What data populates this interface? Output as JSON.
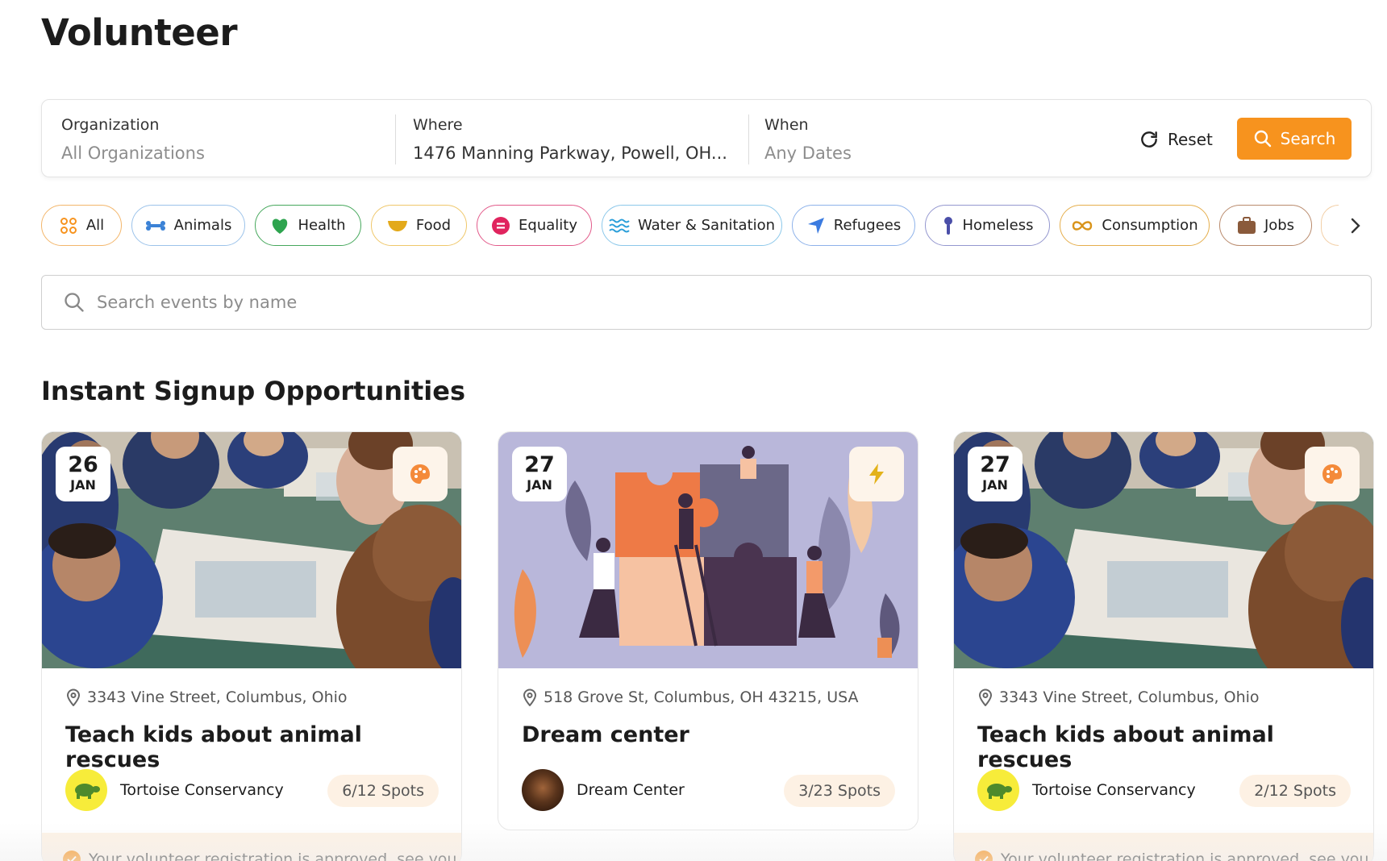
{
  "page": {
    "title": "Volunteer"
  },
  "filters": {
    "organization": {
      "label": "Organization",
      "value": "All Organizations"
    },
    "where": {
      "label": "Where",
      "value": "1476 Manning Parkway, Powell, OH..."
    },
    "when": {
      "label": "When",
      "value": "Any Dates"
    },
    "reset_label": "Reset",
    "search_label": "Search",
    "accent": "#f7931e"
  },
  "categories": [
    {
      "label": "All",
      "icon": "grid-circles-icon",
      "color": "#f7931e"
    },
    {
      "label": "Animals",
      "icon": "bone-icon",
      "color": "#3b82d6"
    },
    {
      "label": "Health",
      "icon": "heart-icon",
      "color": "#2ea44f"
    },
    {
      "label": "Food",
      "icon": "bowl-icon",
      "color": "#e3a91a"
    },
    {
      "label": "Equality",
      "icon": "equality-icon",
      "color": "#e0245e"
    },
    {
      "label": "Water & Sanitation",
      "icon": "waves-icon",
      "color": "#2c9fd9"
    },
    {
      "label": "Refugees",
      "icon": "paper-plane-icon",
      "color": "#3b7be0"
    },
    {
      "label": "Homeless",
      "icon": "pin-person-icon",
      "color": "#4a4ea8"
    },
    {
      "label": "Consumption",
      "icon": "infinity-icon",
      "color": "#d9941a"
    },
    {
      "label": "Jobs",
      "icon": "briefcase-icon",
      "color": "#8a5a3b"
    }
  ],
  "event_search": {
    "placeholder": "Search events by name"
  },
  "section": {
    "title": "Instant Signup Opportunities"
  },
  "cards": [
    {
      "day": "26",
      "month": "JAN",
      "category_icon": "palette-icon",
      "location": "3343 Vine Street, Columbus, Ohio",
      "title": "Teach kids about animal rescues",
      "org": "Tortoise Conservancy",
      "spots": "6/12 Spots",
      "approved": "Your volunteer registration is approved, see you"
    },
    {
      "day": "27",
      "month": "JAN",
      "category_icon": "lightning-icon",
      "location": "518 Grove St, Columbus, OH 43215, USA",
      "title": "Dream center",
      "org": "Dream Center",
      "spots": "3/23 Spots"
    },
    {
      "day": "27",
      "month": "JAN",
      "category_icon": "palette-icon",
      "location": "3343 Vine Street, Columbus, Ohio",
      "title": "Teach kids about animal rescues",
      "org": "Tortoise Conservancy",
      "spots": "2/12 Spots",
      "approved": "Your volunteer registration is approved, see you"
    }
  ]
}
